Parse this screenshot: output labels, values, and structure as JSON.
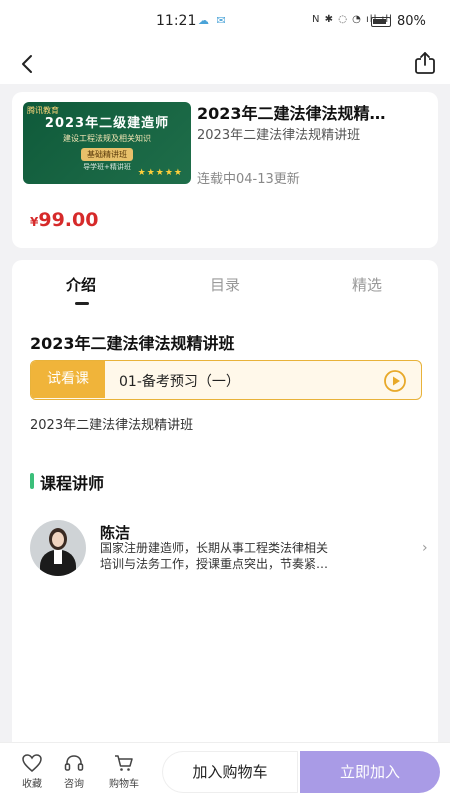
{
  "status_bar": {
    "time": "11:21",
    "battery_text": "80%"
  },
  "course": {
    "thumbnail": {
      "brand": "腾讯教育",
      "title": "2023年二级建造师",
      "subtitle": "建设工程法规及相关知识",
      "pill": "基础精讲班",
      "tagline": "导学班+精讲班",
      "stars": "★★★★★"
    },
    "title": "2023年二建法律法规精…",
    "subtitle": "2023年二建法律法规精讲班",
    "update": "连载中04-13更新",
    "price_symbol": "¥",
    "price_value": "99.00"
  },
  "tabs": [
    {
      "label": "介绍"
    },
    {
      "label": "目录"
    },
    {
      "label": "精选"
    }
  ],
  "intro": {
    "title": "2023年二建法律法规精讲班",
    "trial_tag": "试看课",
    "trial_lesson": "01-备考预习（一）",
    "description": "2023年二建法律法规精讲班"
  },
  "teacher_section": {
    "heading": "课程讲师",
    "name": "陈洁",
    "bio_line1": "国家注册建造师，长期从事工程类法律相关",
    "bio_line2": "培训与法务工作，授课重点突出，节奏紧…"
  },
  "bottom_bar": {
    "favorite": "收藏",
    "consult": "咨询",
    "cart": "购物车",
    "add_to_cart": "加入购物车",
    "join_now": "立即加入"
  },
  "colors": {
    "price": "#d62a2a",
    "trial_accent": "#f0b43a",
    "join_button": "#a99be6",
    "section_bar": "#3bbf7a"
  }
}
